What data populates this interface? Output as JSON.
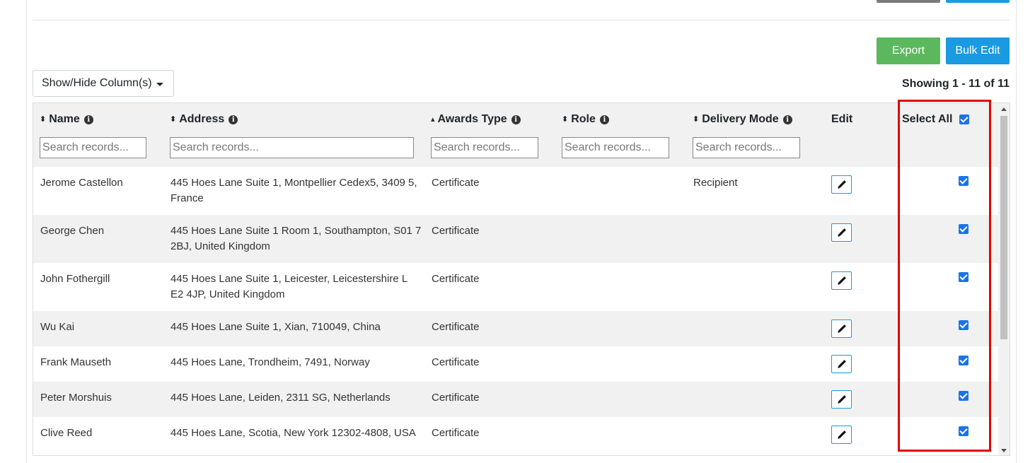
{
  "toolbar": {
    "export_label": "Export",
    "bulk_edit_label": "Bulk Edit",
    "column_toggle_label": "Show/Hide Column(s)",
    "showing_text": "Showing 1 - 11 of 11"
  },
  "table": {
    "columns": [
      {
        "label": "Name",
        "sort_icon": "⬍",
        "search_placeholder": "Search records..."
      },
      {
        "label": "Address",
        "sort_icon": "⬍",
        "search_placeholder": "Search records..."
      },
      {
        "label": "Awards Type",
        "sort_icon": "▴",
        "search_placeholder": "Search records..."
      },
      {
        "label": "Role",
        "sort_icon": "⬍",
        "search_placeholder": "Search records..."
      },
      {
        "label": "Delivery Mode",
        "sort_icon": "⬍",
        "search_placeholder": "Search records..."
      }
    ],
    "edit_header": "Edit",
    "select_all_label": "Select All",
    "info_glyph": "i",
    "rows": [
      {
        "name": "Jerome Castellon",
        "address": "445 Hoes Lane Suite 1, Montpellier Cedex5, 3409 5, France",
        "award_type": "Certificate",
        "role": "",
        "delivery_mode": "Recipient",
        "selected": true
      },
      {
        "name": "George Chen",
        "address": "445 Hoes Lane Suite 1 Room 1, Southampton, S01 7 2BJ, United Kingdom",
        "award_type": "Certificate",
        "role": "",
        "delivery_mode": "",
        "selected": true
      },
      {
        "name": "John Fothergill",
        "address": "445 Hoes Lane Suite 1, Leicester, Leicestershire L E2 4JP, United Kingdom",
        "award_type": "Certificate",
        "role": "",
        "delivery_mode": "",
        "selected": true
      },
      {
        "name": "Wu Kai",
        "address": "445 Hoes Lane Suite 1, Xian, 710049, China",
        "award_type": "Certificate",
        "role": "",
        "delivery_mode": "",
        "selected": true
      },
      {
        "name": "Frank Mauseth",
        "address": "445 Hoes Lane, Trondheim, 7491, Norway",
        "award_type": "Certificate",
        "role": "",
        "delivery_mode": "",
        "selected": true
      },
      {
        "name": "Peter Morshuis",
        "address": "445 Hoes Lane, Leiden, 2311 SG, Netherlands",
        "award_type": "Certificate",
        "role": "",
        "delivery_mode": "",
        "selected": true
      },
      {
        "name": "Clive Reed",
        "address": "445 Hoes Lane, Scotia, New York 12302-4808, USA",
        "award_type": "Certificate",
        "role": "",
        "delivery_mode": "",
        "selected": true
      }
    ]
  },
  "colors": {
    "export": "#5cb85c",
    "bulk_edit": "#1a9ae0",
    "highlight": "#e00000",
    "checkbox": "#1a73e8"
  }
}
